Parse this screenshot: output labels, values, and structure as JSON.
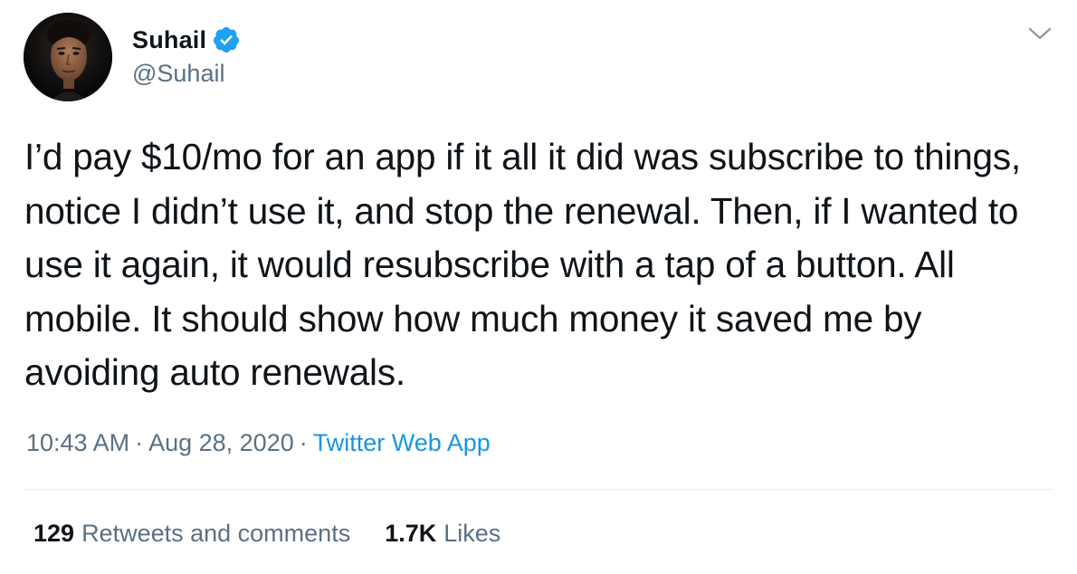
{
  "author": {
    "display_name": "Suhail",
    "handle": "@Suhail",
    "verified": true,
    "avatar_icon": "profile-photo"
  },
  "tweet": {
    "text": "I’d pay $10/mo for an app if it all it did was subscribe to things, notice I didn’t use it, and stop the renewal. Then, if I wanted to use it again, it would resubscribe with a tap of a button. All mobile. It should show how much money it saved me by avoiding auto renewals.",
    "time": "10:43 AM",
    "date": "Aug 28, 2020",
    "source": "Twitter Web App",
    "separator": "·"
  },
  "stats": {
    "retweets_count": "129",
    "retweets_label": "Retweets and comments",
    "likes_count": "1.7K",
    "likes_label": "Likes"
  },
  "colors": {
    "text": "#0f1419",
    "secondary": "#5b7083",
    "link": "#1b95e0",
    "verified_badge": "#1da1f2",
    "divider": "#e6ecf0"
  },
  "icons": {
    "verified": "verified-badge-icon",
    "more": "chevron-down-icon"
  }
}
